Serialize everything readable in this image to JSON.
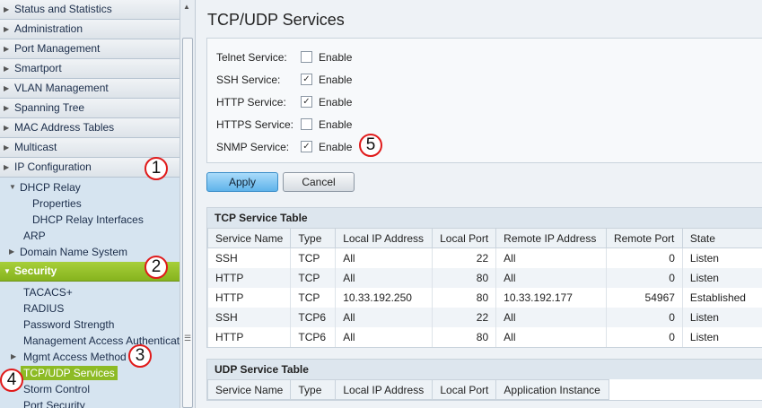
{
  "sidebar": {
    "top_items": [
      {
        "label": "Status and Statistics"
      },
      {
        "label": "Administration"
      },
      {
        "label": "Port Management"
      },
      {
        "label": "Smartport"
      },
      {
        "label": "VLAN Management"
      },
      {
        "label": "Spanning Tree"
      },
      {
        "label": "MAC Address Tables"
      },
      {
        "label": "Multicast"
      },
      {
        "label": "IP Configuration"
      }
    ],
    "ip_sub": {
      "dhcp_relay": "DHCP Relay",
      "properties": "Properties",
      "dhcp_relay_interfaces": "DHCP Relay Interfaces",
      "arp": "ARP",
      "dns": "Domain Name System"
    },
    "security": "Security",
    "security_sub": {
      "tacacs": "TACACS+",
      "radius": "RADIUS",
      "password_strength": "Password Strength",
      "mgmt_access_auth": "Management Access Authentication",
      "mgmt_access_method": "Mgmt Access Method",
      "tcp_udp": "TCP/UDP Services",
      "storm_control": "Storm Control",
      "port_security": "Port Security"
    }
  },
  "page": {
    "title": "TCP/UDP Services",
    "services": [
      {
        "label": "Telnet Service:",
        "checked": false,
        "enable": "Enable"
      },
      {
        "label": "SSH Service:",
        "checked": true,
        "enable": "Enable"
      },
      {
        "label": "HTTP Service:",
        "checked": true,
        "enable": "Enable"
      },
      {
        "label": "HTTPS Service:",
        "checked": false,
        "enable": "Enable"
      },
      {
        "label": "SNMP Service:",
        "checked": true,
        "enable": "Enable"
      }
    ],
    "apply": "Apply",
    "cancel": "Cancel",
    "tcp_table": {
      "title": "TCP Service Table",
      "headers": [
        "Service Name",
        "Type",
        "Local IP Address",
        "Local Port",
        "Remote IP Address",
        "Remote Port",
        "State"
      ],
      "rows": [
        [
          "SSH",
          "TCP",
          "All",
          "22",
          "All",
          "0",
          "Listen"
        ],
        [
          "HTTP",
          "TCP",
          "All",
          "80",
          "All",
          "0",
          "Listen"
        ],
        [
          "HTTP",
          "TCP",
          "10.33.192.250",
          "80",
          "10.33.192.177",
          "54967",
          "Established"
        ],
        [
          "SSH",
          "TCP6",
          "All",
          "22",
          "All",
          "0",
          "Listen"
        ],
        [
          "HTTP",
          "TCP6",
          "All",
          "80",
          "All",
          "0",
          "Listen"
        ]
      ]
    },
    "udp_table": {
      "title": "UDP Service Table",
      "headers": [
        "Service Name",
        "Type",
        "Local IP Address",
        "Local Port",
        "Application Instance"
      ]
    }
  },
  "callouts": [
    "1",
    "2",
    "3",
    "4",
    "5"
  ],
  "colors": {
    "security_active": "#8dbb25",
    "callout_border": "#e01a1a",
    "apply_button": "#5fb3ea"
  }
}
